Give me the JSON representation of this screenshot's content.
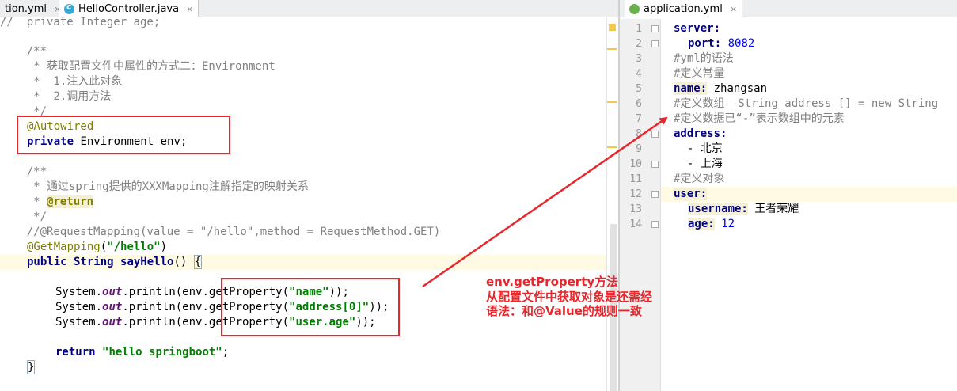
{
  "left_tabs": [
    {
      "label": "tion.yml",
      "close": "×"
    },
    {
      "label": "HelloController.java",
      "close": "×"
    }
  ],
  "right_tab": {
    "label": "application.yml",
    "close": "×"
  },
  "code_lines": {
    "l0": "//  private Integer age;",
    "l1": "    /**",
    "l2": "     * 获取配置文件中属性的方式二：Environment",
    "l3": "     *  1.注入此对象",
    "l4": "     *  2.调用方法",
    "l5": "     */",
    "l6a": "@Autowired",
    "l7a": "private",
    "l7b": " Environment env;",
    "l8": "    /**",
    "l9": "     * 通过spring提供的XXXMapping注解指定的映射关系",
    "l10a": "     * ",
    "l10b": "@return",
    "l11": "     */",
    "l12": "    //@RequestMapping(value = \"/hello\",method = RequestMethod.GET)",
    "l13a": "@GetMapping",
    "l13b": "(",
    "l13c": "\"/hello\"",
    "l13d": ")",
    "l14a": "public",
    "l14b": " String ",
    "l14c": "sayHello",
    "l14d": "() ",
    "l14e": "{",
    "p1a": "System.",
    "p1b": "out",
    "p1c": ".println(env.getProperty(",
    "p1d": "\"name\"",
    "p1e": "));",
    "p2d": "\"address[0]\"",
    "p3d": "\"user.age\"",
    "r1a": "return",
    "r1b": "\"hello springboot\"",
    "r1c": ";",
    "close": "}"
  },
  "yml_line_numbers": [
    "1",
    "2",
    "3",
    "4",
    "5",
    "6",
    "7",
    "8",
    "9",
    "10",
    "11",
    "12",
    "13",
    "14"
  ],
  "yml": {
    "y1k": "server:",
    "y2k": "port:",
    "y2v": "8082",
    "y3": "#yml的语法",
    "y4": "#定义常量",
    "y5k": "name:",
    "y5v": "zhangsan",
    "y6": "#定义数组  String address [] = new String",
    "y7": "#定义数据已“-”表示数组中的元素",
    "y8k": "address:",
    "y9": "  - 北京",
    "y10": "  - 上海",
    "y11": "#定义对象",
    "y12k": "user:",
    "y13k": "username:",
    "y13v": "王者荣耀",
    "y14k": "age:",
    "y14v": "12"
  },
  "annotation": {
    "text": "env.getProperty方法\n从配置文件中获取对象是还需经\n语法：和@Value的规则一致",
    "color": "#e8262b"
  }
}
